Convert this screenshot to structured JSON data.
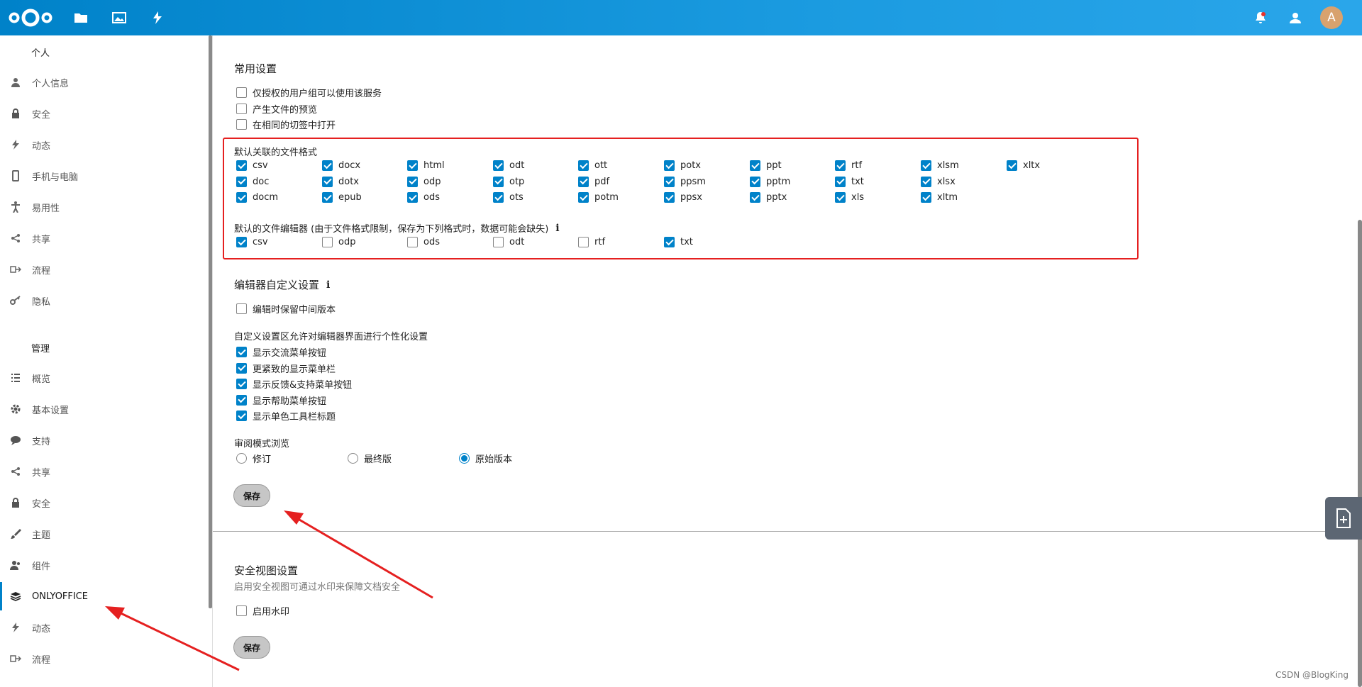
{
  "header": {
    "avatar_letter": "A"
  },
  "sidebar": {
    "personal_heading": "个人",
    "personal_items": [
      {
        "label": "个人信息",
        "icon": "user-icon"
      },
      {
        "label": "安全",
        "icon": "lock-icon"
      },
      {
        "label": "动态",
        "icon": "activity-icon"
      },
      {
        "label": "手机与电脑",
        "icon": "mobile-icon"
      },
      {
        "label": "易用性",
        "icon": "accessibility-icon"
      },
      {
        "label": "共享",
        "icon": "share-icon"
      },
      {
        "label": "流程",
        "icon": "flow-icon"
      },
      {
        "label": "隐私",
        "icon": "key-icon"
      }
    ],
    "admin_heading": "管理",
    "admin_items": [
      {
        "label": "概览",
        "icon": "list-icon"
      },
      {
        "label": "基本设置",
        "icon": "gear-icon"
      },
      {
        "label": "支持",
        "icon": "chat-icon"
      },
      {
        "label": "共享",
        "icon": "share-icon"
      },
      {
        "label": "安全",
        "icon": "lock-icon"
      },
      {
        "label": "主题",
        "icon": "brush-icon"
      },
      {
        "label": "组件",
        "icon": "group-icon"
      },
      {
        "label": "ONLYOFFICE",
        "icon": "layers-icon",
        "active": true
      },
      {
        "label": "动态",
        "icon": "activity-icon"
      },
      {
        "label": "流程",
        "icon": "flow-icon"
      }
    ]
  },
  "common": {
    "title": "常用设置",
    "options": [
      {
        "label": "仅授权的用户组可以使用该服务",
        "checked": false
      },
      {
        "label": "产生文件的预览",
        "checked": false
      },
      {
        "label": "在相同的切签中打开",
        "checked": false
      }
    ]
  },
  "formats": {
    "default_label": "默认关联的文件格式",
    "default_formats": [
      [
        "csv",
        "docx",
        "html",
        "odt",
        "ott",
        "potx",
        "ppt",
        "rtf",
        "xlsm",
        "xltx"
      ],
      [
        "doc",
        "dotx",
        "odp",
        "otp",
        "pdf",
        "ppsm",
        "pptm",
        "txt",
        "xlsx"
      ],
      [
        "docm",
        "epub",
        "ods",
        "ots",
        "potm",
        "ppsx",
        "pptx",
        "xls",
        "xltm"
      ]
    ],
    "editor_label": "默认的文件编辑器 (由于文件格式限制，保存为下列格式时，数据可能会缺失)",
    "editor_info": "i",
    "editor_formats": [
      {
        "label": "csv",
        "checked": true
      },
      {
        "label": "odp",
        "checked": false
      },
      {
        "label": "ods",
        "checked": false
      },
      {
        "label": "odt",
        "checked": false
      },
      {
        "label": "rtf",
        "checked": false
      },
      {
        "label": "txt",
        "checked": true
      }
    ]
  },
  "editor_custom": {
    "title": "编辑器自定义设置",
    "info": "i",
    "keep_versions": "编辑时保留中间版本",
    "custom_intro": "自定义设置区允许对编辑器界面进行个性化设置",
    "custom_options": [
      "显示交流菜单按钮",
      "更紧致的显示菜单栏",
      "显示反馈&支持菜单按钮",
      "显示帮助菜单按钮",
      "显示单色工具栏标题"
    ],
    "review_label": "审阅模式浏览",
    "review_options": [
      {
        "label": "修订",
        "checked": false
      },
      {
        "label": "最终版",
        "checked": false
      },
      {
        "label": "原始版本",
        "checked": true
      }
    ],
    "save": "保存"
  },
  "secure_view": {
    "title": "安全视图设置",
    "subtitle": "启用安全视图可通过水印来保障文档安全",
    "watermark_option": "启用水印",
    "save": "保存"
  },
  "watermark_text": "CSDN @BlogKing",
  "colors": {
    "header_start": "#0082c9",
    "accent": "#0082c9",
    "annotation": "#e52020"
  }
}
